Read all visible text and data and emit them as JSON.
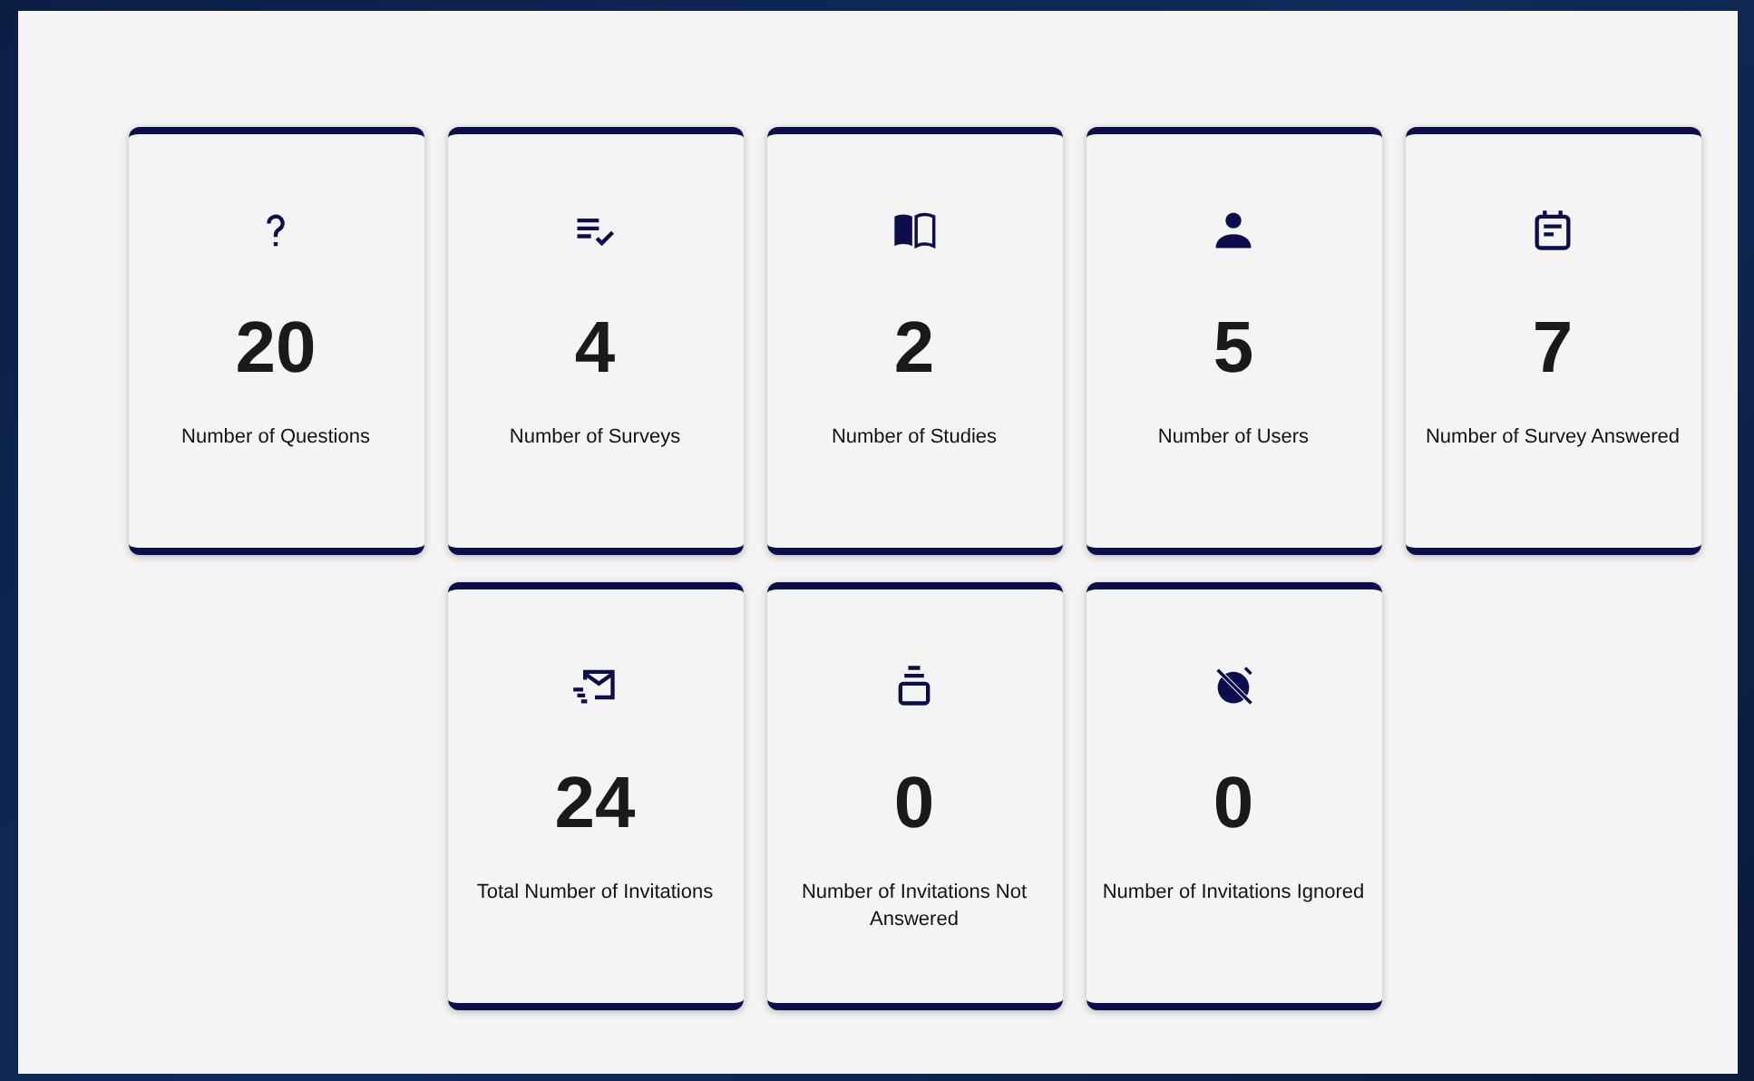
{
  "rows": [
    {
      "cards": [
        {
          "value": "20",
          "label": "Number of Questions"
        },
        {
          "value": "4",
          "label": "Number of Surveys"
        },
        {
          "value": "2",
          "label": "Number of Studies"
        },
        {
          "value": "5",
          "label": "Number of Users"
        },
        {
          "value": "7",
          "label": "Number of Survey Answered"
        }
      ]
    },
    {
      "cards": [
        {
          "value": "24",
          "label": "Total Number of Invitations"
        },
        {
          "value": "0",
          "label": "Number of Invitations Not Answered"
        },
        {
          "value": "0",
          "label": "Number of Invitations Ignored"
        }
      ]
    }
  ]
}
